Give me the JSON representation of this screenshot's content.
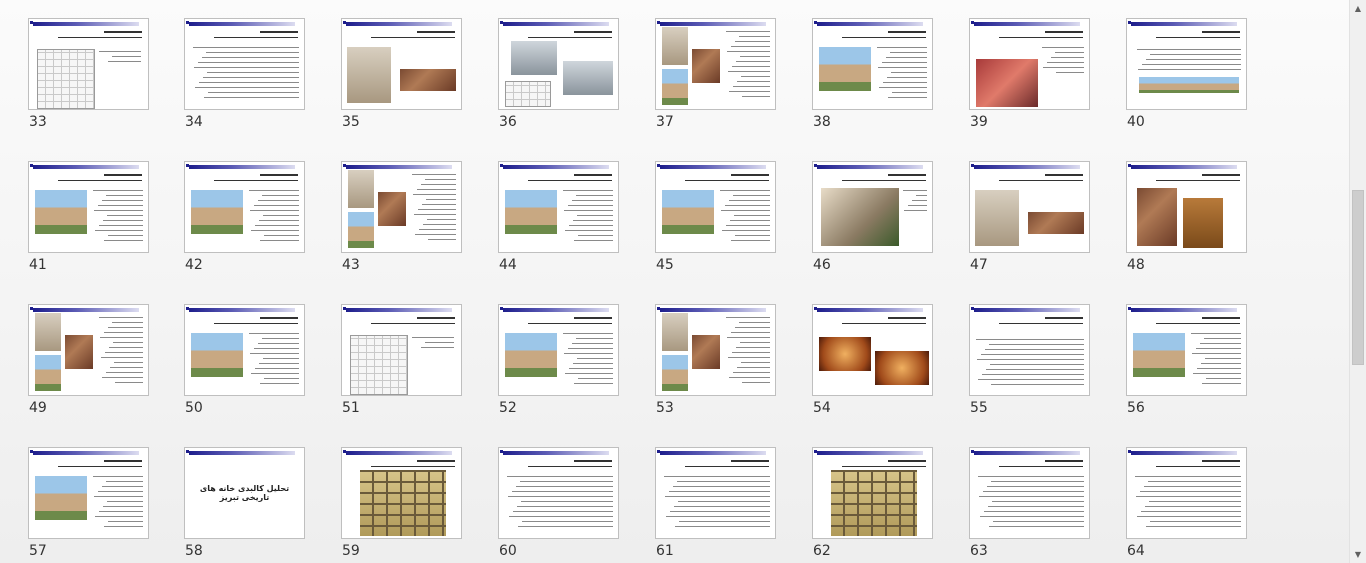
{
  "slide_sorter": {
    "slides": [
      {
        "number": "33",
        "kind": "plan-left"
      },
      {
        "number": "34",
        "kind": "text"
      },
      {
        "number": "35",
        "kind": "two-photo"
      },
      {
        "number": "36",
        "kind": "collage"
      },
      {
        "number": "37",
        "kind": "collage-left"
      },
      {
        "number": "38",
        "kind": "photo-left"
      },
      {
        "number": "39",
        "kind": "photo-red"
      },
      {
        "number": "40",
        "kind": "panorama"
      },
      {
        "number": "41",
        "kind": "photo-left"
      },
      {
        "number": "42",
        "kind": "photo-left"
      },
      {
        "number": "43",
        "kind": "collage-left"
      },
      {
        "number": "44",
        "kind": "photo-left"
      },
      {
        "number": "45",
        "kind": "photo-left"
      },
      {
        "number": "46",
        "kind": "photo-big"
      },
      {
        "number": "47",
        "kind": "two-photo"
      },
      {
        "number": "48",
        "kind": "doors"
      },
      {
        "number": "49",
        "kind": "collage-left"
      },
      {
        "number": "50",
        "kind": "photo-left"
      },
      {
        "number": "51",
        "kind": "plan-left"
      },
      {
        "number": "52",
        "kind": "photo-left"
      },
      {
        "number": "53",
        "kind": "collage-left"
      },
      {
        "number": "54",
        "kind": "two-photo-warm"
      },
      {
        "number": "55",
        "kind": "text-bold"
      },
      {
        "number": "56",
        "kind": "photo-left"
      },
      {
        "number": "57",
        "kind": "photo-left"
      },
      {
        "number": "58",
        "kind": "title",
        "title": "تحلیل کالبدی خانه های تاریخی تبریز"
      },
      {
        "number": "59",
        "kind": "grid-photo"
      },
      {
        "number": "60",
        "kind": "text"
      },
      {
        "number": "61",
        "kind": "text"
      },
      {
        "number": "62",
        "kind": "grid-photo"
      },
      {
        "number": "63",
        "kind": "text"
      },
      {
        "number": "64",
        "kind": "text"
      }
    ]
  },
  "scrollbar": {
    "up_arrow": "▲",
    "down_arrow": "▼",
    "position": 0.49,
    "visible_fraction": 0.33
  },
  "colors": {
    "header_bar": "#1e1e8c",
    "slide_border": "#bfbfbf",
    "background": "#f4f4f4"
  }
}
